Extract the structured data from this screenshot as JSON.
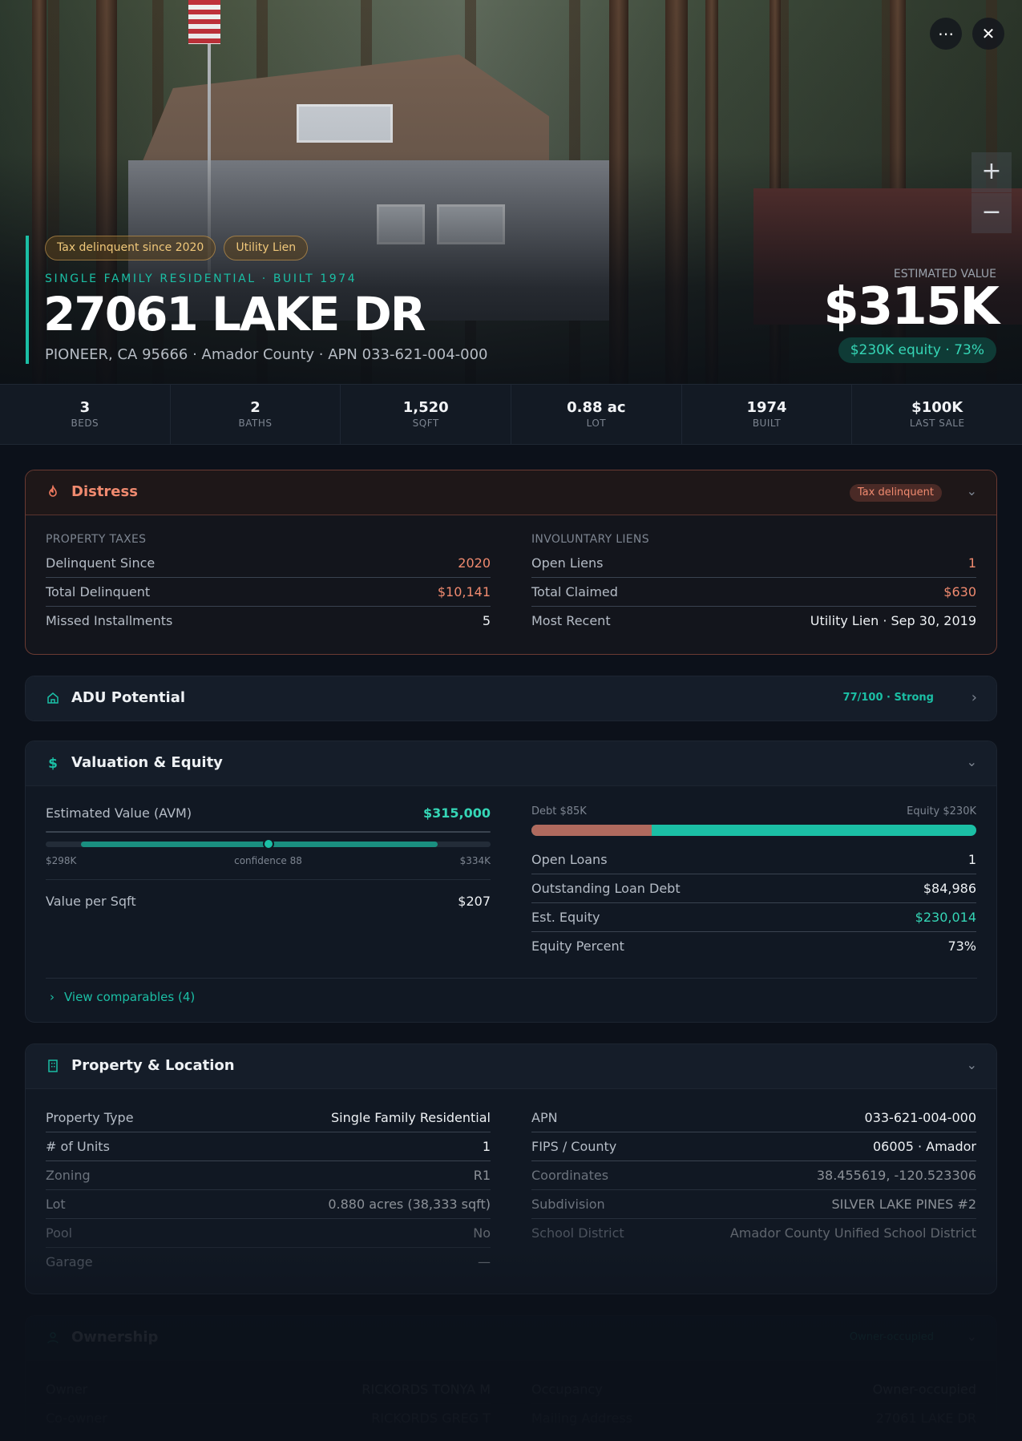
{
  "hero": {
    "more_icon": "more-icon",
    "close_icon": "close-icon",
    "zoom_in": "+",
    "zoom_out": "−",
    "tags": [
      "Tax delinquent since 2020",
      "Utility Lien"
    ],
    "subtitle": "SINGLE FAMILY RESIDENTIAL · BUILT 1974",
    "address": "27061 LAKE DR",
    "location": "PIONEER, CA 95666 · Amador County · APN 033-621-004-000",
    "estimated_label": "ESTIMATED VALUE",
    "estimated_value": "$315K",
    "equity_pill": "$230K equity · 73%"
  },
  "stats": [
    {
      "value": "3",
      "label": "BEDS"
    },
    {
      "value": "2",
      "label": "BATHS"
    },
    {
      "value": "1,520",
      "label": "SQFT"
    },
    {
      "value": "0.88 ac",
      "label": "LOT"
    },
    {
      "value": "1974",
      "label": "BUILT"
    },
    {
      "value": "$100K",
      "label": "LAST SALE"
    }
  ],
  "distress": {
    "title": "Distress",
    "badge": "Tax delinquent",
    "taxes_label": "PROPERTY TAXES",
    "liens_label": "INVOLUNTARY LIENS",
    "taxes": [
      {
        "k": "Delinquent Since",
        "v": "2020"
      },
      {
        "k": "Total Delinquent",
        "v": "$10,141"
      },
      {
        "k": "Missed Installments",
        "v": "5"
      }
    ],
    "liens": [
      {
        "k": "Open Liens",
        "v": "1"
      },
      {
        "k": "Total Claimed",
        "v": "$630"
      },
      {
        "k": "Most Recent",
        "v": "Utility Lien · Sep 30, 2019"
      }
    ]
  },
  "adu": {
    "title": "ADU Potential",
    "score": "77/100 · Strong"
  },
  "valuation": {
    "title": "Valuation & Equity",
    "avm_label": "Estimated Value (AVM)",
    "avm_value": "$315,000",
    "range_low": "$298K",
    "range_high": "$334K",
    "confidence": "confidence 88",
    "avm_position": 0.5,
    "vps_label": "Value per Sqft",
    "vps_value": "$207",
    "debt_label": "Debt $85K",
    "equity_label": "Equity $230K",
    "debt_fraction": 0.27,
    "rows": [
      {
        "k": "Open Loans",
        "v": "1"
      },
      {
        "k": "Outstanding Loan Debt",
        "v": "$84,986"
      },
      {
        "k": "Est. Equity",
        "v": "$230,014"
      },
      {
        "k": "Equity Percent",
        "v": "73%"
      }
    ],
    "comparables": "View comparables (4)"
  },
  "property": {
    "title": "Property & Location",
    "left": [
      {
        "k": "Property Type",
        "v": "Single Family Residential"
      },
      {
        "k": "# of Units",
        "v": "1"
      },
      {
        "k": "Zoning",
        "v": "R1"
      },
      {
        "k": "Lot",
        "v": "0.880 acres (38,333 sqft)"
      },
      {
        "k": "Pool",
        "v": "No"
      },
      {
        "k": "Garage",
        "v": "—"
      }
    ],
    "right": [
      {
        "k": "APN",
        "v": "033-621-004-000"
      },
      {
        "k": "FIPS / County",
        "v": "06005 · Amador"
      },
      {
        "k": "Coordinates",
        "v": "38.455619, -120.523306"
      },
      {
        "k": "Subdivision",
        "v": "SILVER LAKE PINES #2"
      },
      {
        "k": "School District",
        "v": "Amador County Unified School District"
      }
    ]
  },
  "ownership": {
    "title": "Ownership",
    "badge": "Owner-occupied",
    "left": [
      {
        "k": "Owner",
        "v": "RICKORDS TONYA M"
      },
      {
        "k": "Co-owner",
        "v": "RICKORDS GREG T"
      }
    ],
    "right": [
      {
        "k": "Occupancy",
        "v": "Owner-occupied"
      },
      {
        "k": "Mailing Address",
        "v": "27061 LAKE DR"
      }
    ]
  },
  "colors": {
    "accent": "#1bbfa5",
    "distress": "#f08a6f"
  }
}
